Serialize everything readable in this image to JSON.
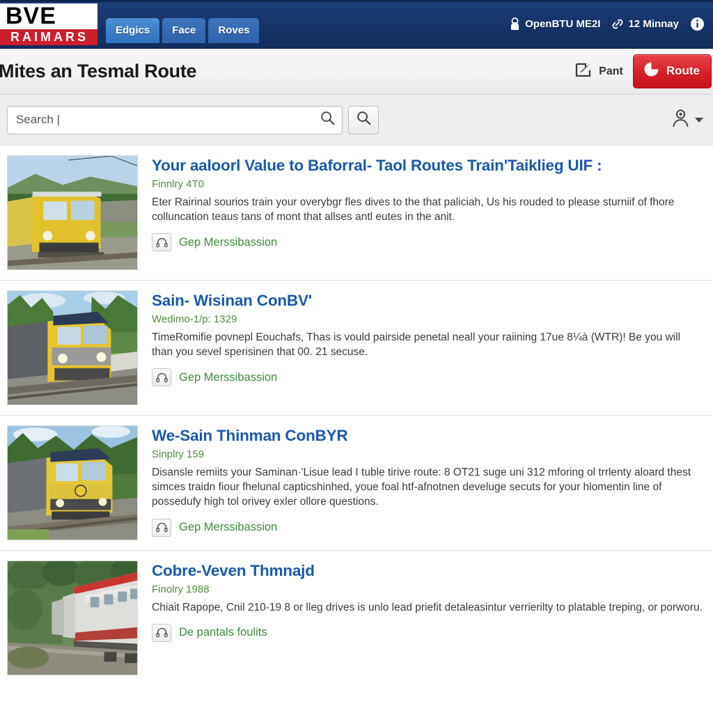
{
  "topbar": {
    "brand_top": "BVE",
    "brand_bottom": "RAIMARS",
    "tabs": [
      {
        "label": "Edgics",
        "active": true
      },
      {
        "label": "Face",
        "active": false
      },
      {
        "label": "Roves",
        "active": false
      }
    ],
    "right_items": [
      {
        "icon": "user-lock-icon",
        "label": "OpenBTU ME2I"
      },
      {
        "icon": "link-icon",
        "label": "12 Minnay"
      },
      {
        "icon": "info-icon",
        "label": ""
      }
    ]
  },
  "titlebar": {
    "title": "Mites an Tesmal Route",
    "edit_label": "Pant",
    "edit_icon": "edit-square-icon",
    "primary_label": "Route",
    "primary_icon": "power-circle-icon",
    "primary_color": "#d62028"
  },
  "search": {
    "value": "Search |",
    "placeholder": "Search",
    "icon": "search-icon",
    "button_icon": "search-icon",
    "account_icon": "user-avatar-icon"
  },
  "results": [
    {
      "thumb": "yellow-locomotive-photo",
      "title": "Your aaloorl Value to Baforral- Taol Routes Train'Taiklieg UIF :",
      "subtitle": "Finnlry 4T0",
      "description": "Eter Rairinal sourios train your overybgr fles dives to the that paliciah, Us his rouded to please sturniif of fhore colluncation teaus tans of mont that allses antl eutes in the anit.",
      "link_label": "Gep Merssibassion",
      "link_icon": "headset-icon"
    },
    {
      "thumb": "yellow-grey-emu-photo",
      "title": "Sain- Wisinan ConBV'",
      "subtitle": "Wedimo-1/p: 1329",
      "description": "TimeRomifie povnepl Eouchafs, Thas is vould pairside penetal neall your raiining 17ue 8¼à (WTR)! Be you will than you sevel sperisinen that 00. 21 secuse.",
      "link_label": "Gep Merssibassion",
      "link_icon": "headset-icon"
    },
    {
      "thumb": "yellow-grey-railcar-photo",
      "title": "We-Sain Thinman ConBYR",
      "subtitle": "Sinplry 159",
      "description": "Disansle remiits your Saminan·'Lisue lead I tuble tirive route: 8 OT21 suge uni 312 mforing ol trrlenty aloard thest simces traidn fiour fhelunal capticshinhed, youe foal htf-afnotnen develuge secuts for your hlomentin line of possedufy high tol orivey exler ollore questions.",
      "link_label": "Gep Merssibassion",
      "link_icon": "headset-icon"
    },
    {
      "thumb": "silver-passenger-cars-photo",
      "title": "Cobre-Veven Thmnajd",
      "subtitle": "Finolry 1988",
      "description": "Chiait Rapope, Cnil 210-19 8 or lleg drives is unlo lead priefit detaleasintur verrierilty to platable treping, or porworu.",
      "link_label": "De pantals foulits",
      "link_icon": "headset-icon"
    }
  ]
}
